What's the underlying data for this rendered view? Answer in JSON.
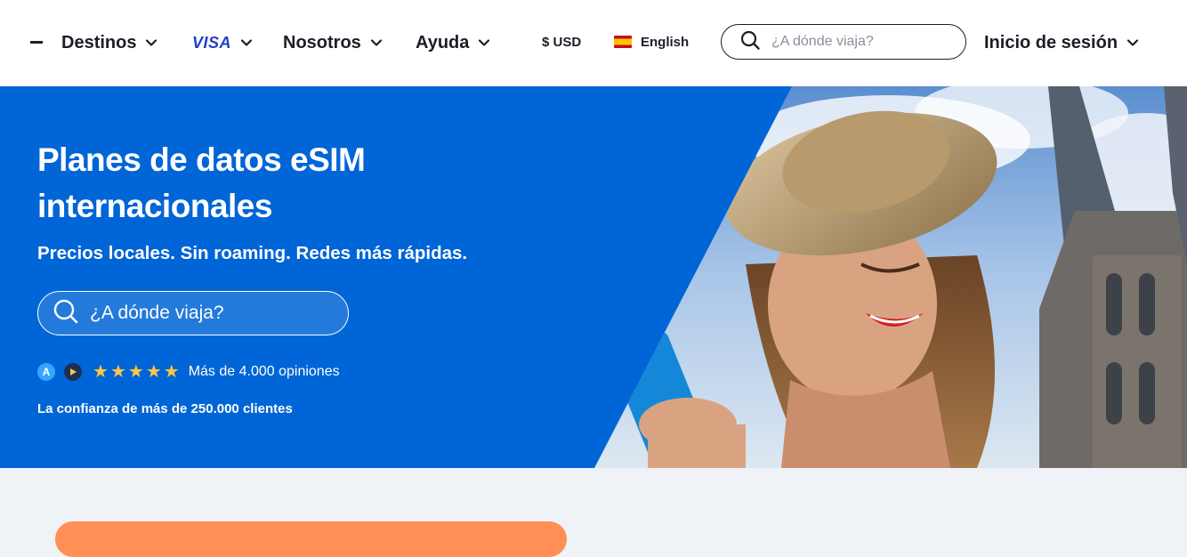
{
  "nav": {
    "destinations": "Destinos",
    "brand_visa": "VISA",
    "about": "Nosotros",
    "help": "Ayuda",
    "currency": "$ USD",
    "language": "English",
    "search_placeholder": "¿A dónde viaja?",
    "login": "Inicio de sesión"
  },
  "hero": {
    "title": "Planes de datos eSIM internacionales",
    "subtitle": "Precios locales. Sin roaming. Redes más rápidas.",
    "search_placeholder": "¿A dónde viaja?",
    "rating_stars": 5,
    "reviews": "Más de 4.000 opiniones",
    "trust": "La confianza de más de 250.000 clientes"
  },
  "colors": {
    "hero_bg": "#0065d6",
    "star": "#ffc83d",
    "cta": "#ff8f54",
    "page_bg": "#eff2f7"
  }
}
